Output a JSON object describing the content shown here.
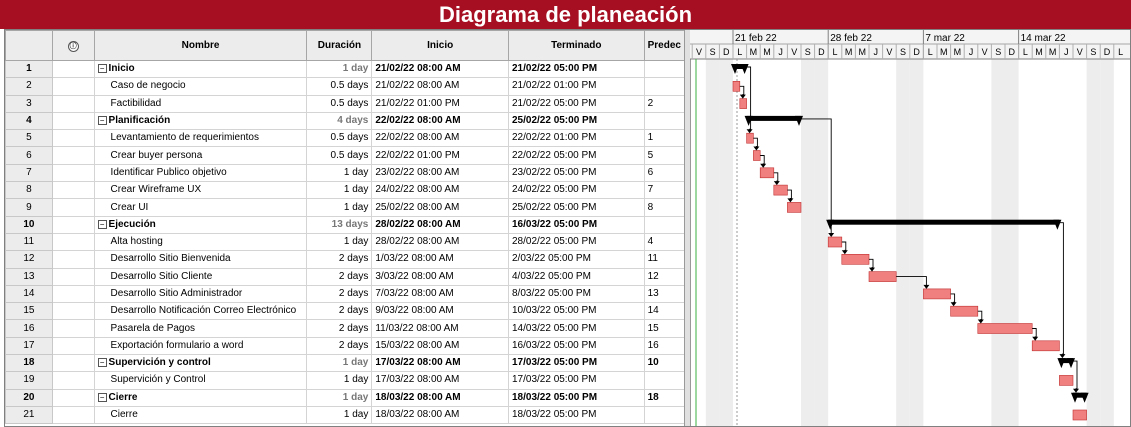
{
  "title": "Diagrama de planeación",
  "columns": {
    "id": "",
    "info": "ⓘ",
    "name": "Nombre",
    "duration": "Duración",
    "start": "Inicio",
    "finish": "Terminado",
    "pred": "Predec"
  },
  "rows": [
    {
      "id": "1",
      "name": "Inicio",
      "duration": "1 day",
      "start": "21/02/22 08:00 AM",
      "finish": "21/02/22 05:00 PM",
      "pred": "",
      "summary": true,
      "s": 0,
      "e": 1
    },
    {
      "id": "2",
      "name": "Caso de negocio",
      "duration": "0.5 days",
      "start": "21/02/22 08:00 AM",
      "finish": "21/02/22 01:00 PM",
      "pred": "",
      "summary": false,
      "s": 0,
      "e": 0.5
    },
    {
      "id": "3",
      "name": "Factibilidad",
      "duration": "0.5 days",
      "start": "21/02/22 01:00 PM",
      "finish": "21/02/22 05:00 PM",
      "pred": "2",
      "summary": false,
      "s": 0.5,
      "e": 1
    },
    {
      "id": "4",
      "name": "Planificación",
      "duration": "4 days",
      "start": "22/02/22 08:00 AM",
      "finish": "25/02/22 05:00 PM",
      "pred": "",
      "summary": true,
      "s": 1,
      "e": 5
    },
    {
      "id": "5",
      "name": "Levantamiento de requerimientos",
      "duration": "0.5 days",
      "start": "22/02/22 08:00 AM",
      "finish": "22/02/22 01:00 PM",
      "pred": "1",
      "summary": false,
      "s": 1,
      "e": 1.5
    },
    {
      "id": "6",
      "name": "Crear buyer persona",
      "duration": "0.5 days",
      "start": "22/02/22 01:00 PM",
      "finish": "22/02/22 05:00 PM",
      "pred": "5",
      "summary": false,
      "s": 1.5,
      "e": 2
    },
    {
      "id": "7",
      "name": "Identificar Publico objetivo",
      "duration": "1 day",
      "start": "23/02/22 08:00 AM",
      "finish": "23/02/22 05:00 PM",
      "pred": "6",
      "summary": false,
      "s": 2,
      "e": 3
    },
    {
      "id": "8",
      "name": "Crear Wireframe UX",
      "duration": "1 day",
      "start": "24/02/22 08:00 AM",
      "finish": "24/02/22 05:00 PM",
      "pred": "7",
      "summary": false,
      "s": 3,
      "e": 4
    },
    {
      "id": "9",
      "name": "Crear UI",
      "duration": "1 day",
      "start": "25/02/22 08:00 AM",
      "finish": "25/02/22 05:00 PM",
      "pred": "8",
      "summary": false,
      "s": 4,
      "e": 5
    },
    {
      "id": "10",
      "name": "Ejecución",
      "duration": "13 days",
      "start": "28/02/22 08:00 AM",
      "finish": "16/03/22 05:00 PM",
      "pred": "",
      "summary": true,
      "s": 7,
      "e": 24
    },
    {
      "id": "11",
      "name": "Alta hosting",
      "duration": "1 day",
      "start": "28/02/22 08:00 AM",
      "finish": "28/02/22 05:00 PM",
      "pred": "4",
      "summary": false,
      "s": 7,
      "e": 8
    },
    {
      "id": "12",
      "name": "Desarrollo Sitio Bienvenida",
      "duration": "2 days",
      "start": "1/03/22 08:00 AM",
      "finish": "2/03/22 05:00 PM",
      "pred": "11",
      "summary": false,
      "s": 8,
      "e": 10
    },
    {
      "id": "13",
      "name": "Desarrollo Sitio Cliente",
      "duration": "2 days",
      "start": "3/03/22 08:00 AM",
      "finish": "4/03/22 05:00 PM",
      "pred": "12",
      "summary": false,
      "s": 10,
      "e": 12
    },
    {
      "id": "14",
      "name": "Desarrollo Sitio Administrador",
      "duration": "2 days",
      "start": "7/03/22 08:00 AM",
      "finish": "8/03/22 05:00 PM",
      "pred": "13",
      "summary": false,
      "s": 14,
      "e": 16
    },
    {
      "id": "15",
      "name": "Desarrollo Notificación Correo Electrónico",
      "duration": "2 days",
      "start": "9/03/22 08:00 AM",
      "finish": "10/03/22 05:00 PM",
      "pred": "14",
      "summary": false,
      "s": 16,
      "e": 18
    },
    {
      "id": "16",
      "name": "Pasarela de Pagos",
      "duration": "2 days",
      "start": "11/03/22 08:00 AM",
      "finish": "14/03/22 05:00 PM",
      "pred": "15",
      "summary": false,
      "s": 18,
      "e": 22
    },
    {
      "id": "17",
      "name": "Exportación formulario a word",
      "duration": "2 days",
      "start": "15/03/22 08:00 AM",
      "finish": "16/03/22 05:00 PM",
      "pred": "16",
      "summary": false,
      "s": 22,
      "e": 24
    },
    {
      "id": "18",
      "name": "Supervición y control",
      "duration": "1 day",
      "start": "17/03/22 08:00 AM",
      "finish": "17/03/22 05:00 PM",
      "pred": "10",
      "summary": true,
      "s": 24,
      "e": 25
    },
    {
      "id": "19",
      "name": "Supervición y Control",
      "duration": "1 day",
      "start": "17/03/22 08:00 AM",
      "finish": "17/03/22 05:00 PM",
      "pred": "",
      "summary": false,
      "s": 24,
      "e": 25
    },
    {
      "id": "20",
      "name": "Cierre",
      "duration": "1 day",
      "start": "18/03/22 08:00 AM",
      "finish": "18/03/22 05:00 PM",
      "pred": "18",
      "summary": true,
      "s": 25,
      "e": 26
    },
    {
      "id": "21",
      "name": "Cierre",
      "duration": "1 day",
      "start": "18/03/22 08:00 AM",
      "finish": "18/03/22 05:00 PM",
      "pred": "",
      "summary": false,
      "s": 25,
      "e": 26
    }
  ],
  "timeline": {
    "weeks": [
      {
        "label": "21 feb 22",
        "offset": 0
      },
      {
        "label": "28 feb 22",
        "offset": 7
      },
      {
        "label": "7 mar 22",
        "offset": 14
      },
      {
        "label": "14 mar 22",
        "offset": 21
      }
    ],
    "prev_days": [
      "V",
      "S",
      "D"
    ],
    "week_days": [
      "L",
      "M",
      "M",
      "J",
      "V",
      "S",
      "D"
    ],
    "colors": {
      "task": "#f08080",
      "task_border": "#c03030",
      "summary": "#000000",
      "weekend": "#ededed",
      "grid": "#d0d0d0",
      "today_line": "#3cb043"
    }
  }
}
